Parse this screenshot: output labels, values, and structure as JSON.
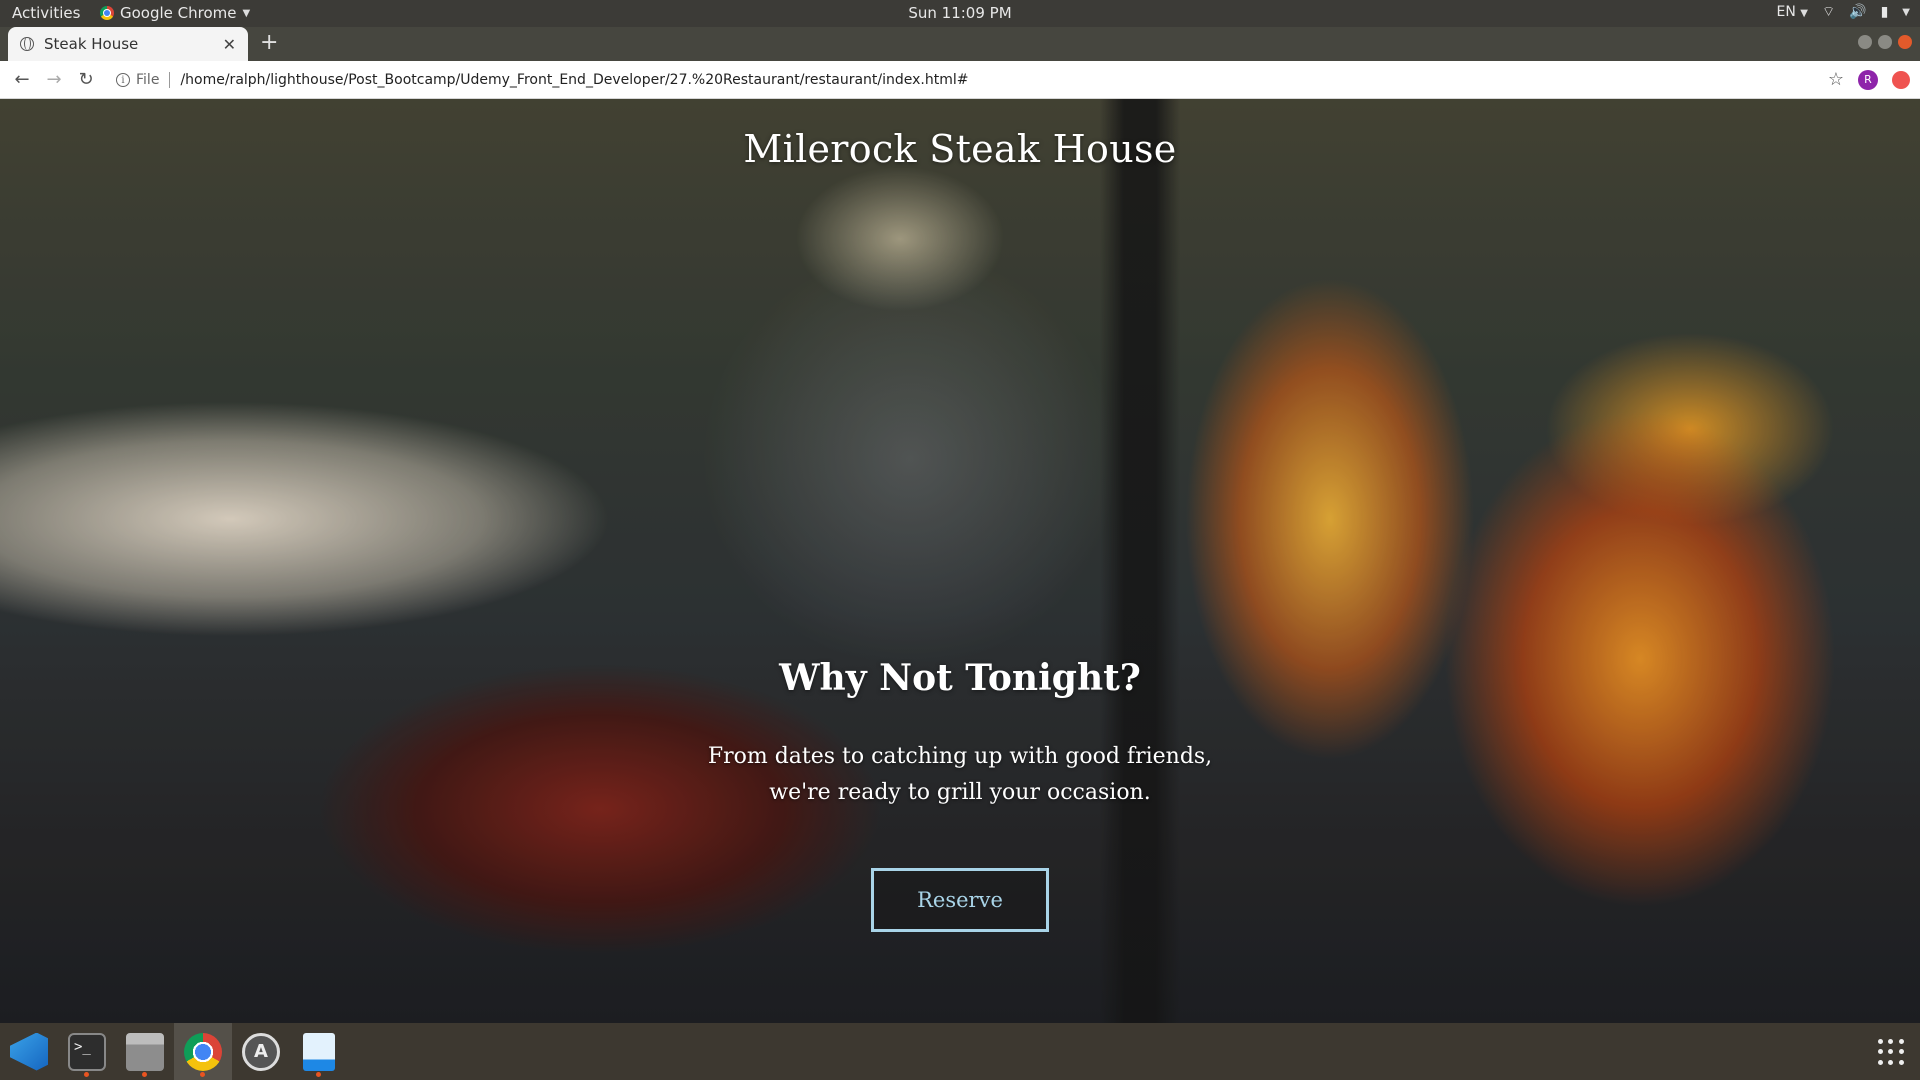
{
  "topbar": {
    "activities": "Activities",
    "app_name": "Google Chrome",
    "clock": "Sun 11:09 PM",
    "language": "EN"
  },
  "browser": {
    "tab_title": "Steak House",
    "new_tab": "+",
    "file_label": "File",
    "url": "/home/ralph/lighthouse/Post_Bootcamp/Udemy_Front_End_Developer/27.%20Restaurant/restaurant/index.html#",
    "profile_initial": "R"
  },
  "page": {
    "brand": "Milerock Steak House",
    "headline": "Why Not Tonight?",
    "tagline_line1": "From dates to catching up with good friends,",
    "tagline_line2": "we're ready to grill your occasion.",
    "button_label": "Reserve",
    "accent_color": "#a9d4e8"
  },
  "dock": {
    "items": [
      "vscode-icon",
      "terminal-icon",
      "files-icon",
      "chrome-icon",
      "software-updater-icon",
      "text-editor-icon"
    ],
    "terminal_glyph": ">_",
    "software_glyph": "A"
  }
}
